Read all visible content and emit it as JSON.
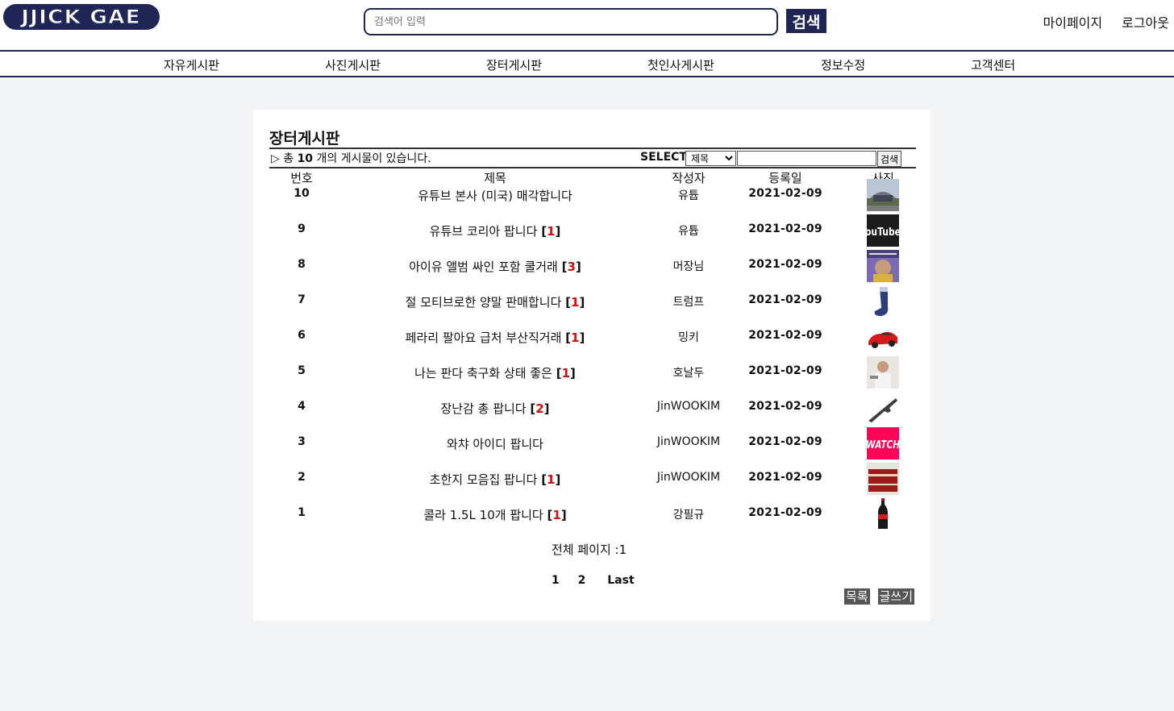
{
  "header": {
    "logo_text": "JJICK GAE",
    "search_placeholder": "검색어 입력",
    "search_button": "검색",
    "user_links": [
      "마이페이지",
      "로그아웃"
    ]
  },
  "nav": [
    "자유게시판",
    "사진게시판",
    "장터게시판",
    "첫인사게시판",
    "정보수정",
    "고객센터"
  ],
  "board": {
    "title": "장터게시판",
    "count_prefix": "▷ 총 ",
    "count": "10",
    "count_suffix": " 개의 게시물이 있습니다.",
    "select_label": "SELECT",
    "select_value": "제목",
    "filter_button": "검색",
    "columns": [
      "번호",
      "제목",
      "작성자",
      "등록일",
      "사진"
    ],
    "rows": [
      {
        "num": "10",
        "title": "유튜브 본사 (미국) 매각합니다",
        "comments": "",
        "author": "유튭",
        "date": "2021-02-09",
        "photo": "building-photo"
      },
      {
        "num": "9",
        "title": "유튜브 코리아 팝니다",
        "comments": "1",
        "author": "유튭",
        "date": "2021-02-09",
        "photo": "youtube-logo-photo"
      },
      {
        "num": "8",
        "title": "아이유 앨범 싸인 포함 쿨거래",
        "comments": "3",
        "author": "머장님",
        "date": "2021-02-09",
        "photo": "album-photo"
      },
      {
        "num": "7",
        "title": "절 모티브로한 양말 판매합니다",
        "comments": "1",
        "author": "트럼프",
        "date": "2021-02-09",
        "photo": "sock-photo"
      },
      {
        "num": "6",
        "title": "페라리 팔아요 급처 부산직거래",
        "comments": "1",
        "author": "밍키",
        "date": "2021-02-09",
        "photo": "car-photo"
      },
      {
        "num": "5",
        "title": "나는 판다 축구화 상태 좋은 ",
        "comments": "1",
        "author": "호날두",
        "date": "2021-02-09",
        "photo": "person-photo"
      },
      {
        "num": "4",
        "title": "장난감 총 팝니다",
        "comments": "2",
        "author": "JinWOOKIM",
        "date": "2021-02-09",
        "photo": "toy-gun-photo"
      },
      {
        "num": "3",
        "title": "와챠 아이디 팝니다",
        "comments": "",
        "author": "JinWOOKIM",
        "date": "2021-02-09",
        "photo": "watcha-logo-photo"
      },
      {
        "num": "2",
        "title": "초한지 모음집 팝니다",
        "comments": "1",
        "author": "JinWOOKIM",
        "date": "2021-02-09",
        "photo": "book-set-photo"
      },
      {
        "num": "1",
        "title": "콜라 1.5L 10개 팝니다",
        "comments": "1",
        "author": "강필규",
        "date": "2021-02-09",
        "photo": "cola-bottle-photo"
      }
    ],
    "total_pages_label": "전체 페이지 :1",
    "pages": [
      "1",
      "2"
    ],
    "last_label": "Last",
    "list_button": "목록",
    "write_button": "글쓰기"
  }
}
